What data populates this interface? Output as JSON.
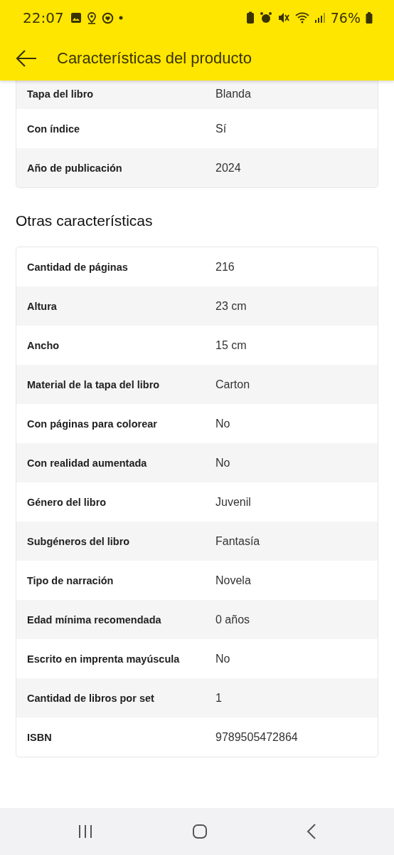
{
  "status_bar": {
    "time": "22:07",
    "battery": "76%"
  },
  "header": {
    "title": "Características del producto"
  },
  "main_features": [
    {
      "label": "Tapa del libro",
      "value": "Blanda"
    },
    {
      "label": "Con índice",
      "value": "Sí"
    },
    {
      "label": "Año de publicación",
      "value": "2024"
    }
  ],
  "other_section": {
    "title": "Otras características",
    "rows": [
      {
        "label": "Cantidad de páginas",
        "value": "216"
      },
      {
        "label": "Altura",
        "value": "23 cm"
      },
      {
        "label": "Ancho",
        "value": "15 cm"
      },
      {
        "label": "Material de la tapa del libro",
        "value": "Carton"
      },
      {
        "label": "Con páginas para colorear",
        "value": "No"
      },
      {
        "label": "Con realidad aumentada",
        "value": "No"
      },
      {
        "label": "Género del libro",
        "value": "Juvenil"
      },
      {
        "label": "Subgéneros del libro",
        "value": "Fantasía"
      },
      {
        "label": "Tipo de narración",
        "value": "Novela"
      },
      {
        "label": "Edad mínima recomendada",
        "value": "0 años"
      },
      {
        "label": "Escrito en imprenta mayúscula",
        "value": "No"
      },
      {
        "label": "Cantidad de libros por set",
        "value": "1"
      },
      {
        "label": "ISBN",
        "value": "9789505472864"
      }
    ]
  }
}
